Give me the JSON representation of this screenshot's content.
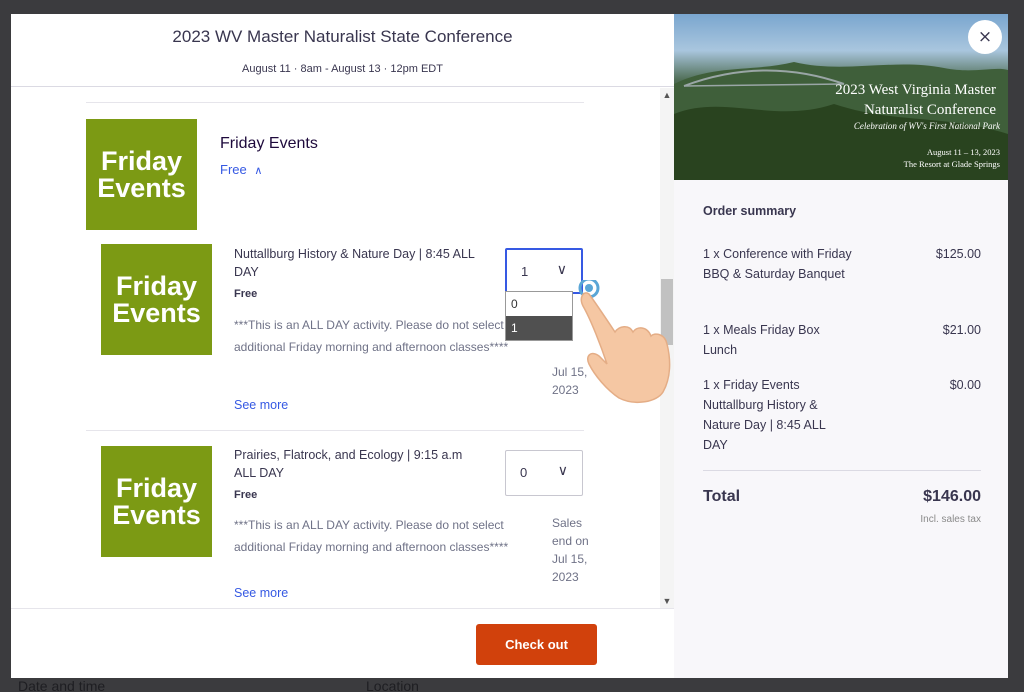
{
  "backdrop": {
    "date_time": "Date and time",
    "location": "Location"
  },
  "header": {
    "title": "2023 WV Master Naturalist State Conference",
    "date": "August 11 · 8am - August 13 · 12pm EDT"
  },
  "group": {
    "image_text": [
      "Friday",
      "Events"
    ],
    "title": "Friday Events",
    "price_toggle": "Free"
  },
  "tickets": [
    {
      "image_text": [
        "Friday",
        "Events"
      ],
      "name": "Nuttallburg History & Nature Day | 8:45 ALL DAY",
      "price": "Free",
      "desc_line1": "***This is an ALL DAY activity. Please do not select",
      "desc_line2": "additional Friday morning and afternoon classes****",
      "sales_end": "Jul 15, 2023",
      "see_more": "See more",
      "quantity": "1"
    },
    {
      "image_text": [
        "Friday",
        "Events"
      ],
      "name": "Prairies, Flatrock, and Ecology | 9:15 a.m ALL DAY",
      "price": "Free",
      "desc_line1": "***This is an ALL DAY activity. Please do not select",
      "desc_line2": "additional Friday morning and afternoon classes****",
      "sales_end": "Sales end on Jul 15, 2023",
      "see_more": "See more",
      "quantity": "0"
    }
  ],
  "dropdown": {
    "options": [
      "0",
      "1"
    ],
    "selected": "1"
  },
  "footer": {
    "checkout_label": "Check out"
  },
  "banner": {
    "line1": "2023 West Virginia Master",
    "line2": "Naturalist Conference",
    "line3": "Celebration of WV's First National Park",
    "line4": "August 11 – 13, 2023",
    "line5": "The Resort at Glade Springs"
  },
  "close_label": "×",
  "summary": {
    "title": "Order summary",
    "items": [
      {
        "desc": "1 x Conference with Friday BBQ & Saturday Banquet",
        "amount": "$125.00"
      },
      {
        "desc": "1 x Meals Friday Box Lunch",
        "amount": "$21.00"
      },
      {
        "desc": "1 x Friday Events Nuttallburg History & Nature Day | 8:45 ALL DAY",
        "amount": "$0.00"
      }
    ],
    "total_label": "Total",
    "total_amount": "$146.00",
    "tax_note": "Incl. sales tax"
  },
  "colors": {
    "brand_orange": "#d1410c",
    "link_blue": "#3659e3",
    "event_green": "#7c9a14"
  }
}
